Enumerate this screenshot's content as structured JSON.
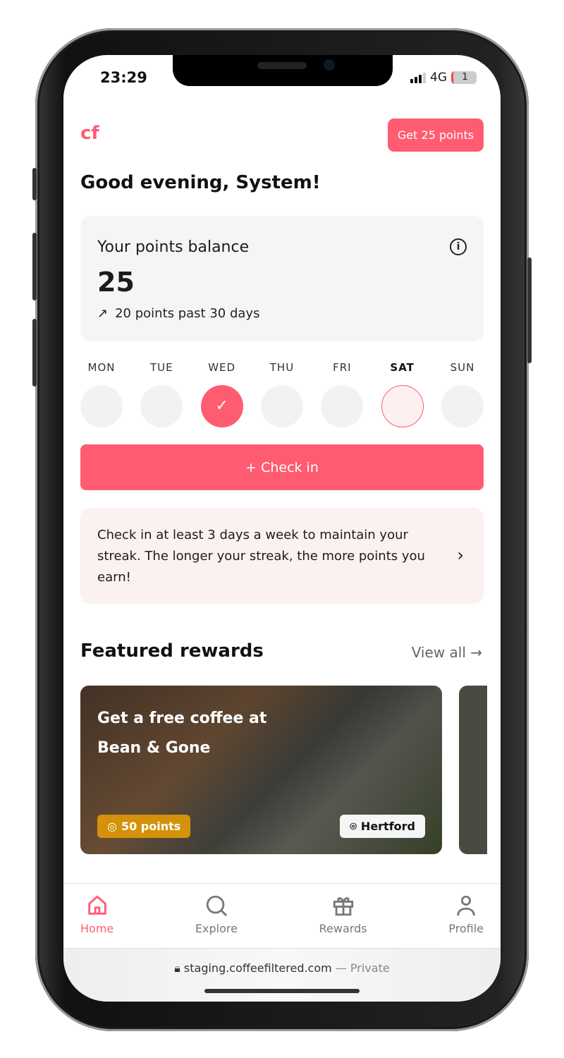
{
  "status": {
    "time": "23:29",
    "network": "4G",
    "battery": "1"
  },
  "header": {
    "logo": "cf",
    "cta": "Get 25 points"
  },
  "greeting": "Good evening, System!",
  "points": {
    "title": "Your points balance",
    "value": "25",
    "trend": "20 points past 30 days"
  },
  "week": [
    {
      "label": "MON",
      "state": "empty"
    },
    {
      "label": "TUE",
      "state": "empty"
    },
    {
      "label": "WED",
      "state": "checked"
    },
    {
      "label": "THU",
      "state": "empty"
    },
    {
      "label": "FRI",
      "state": "empty"
    },
    {
      "label": "SAT",
      "state": "today"
    },
    {
      "label": "SUN",
      "state": "empty"
    }
  ],
  "checkin": {
    "label": "+ Check in"
  },
  "tip": "Check in at least 3 days a week to maintain your streak. The longer your streak, the more points you earn!",
  "featured": {
    "title": "Featured rewards",
    "view_all": "View all",
    "items": [
      {
        "title": "Get a free coffee at Bean & Gone",
        "points": "50 points",
        "location": "Hertford"
      }
    ]
  },
  "nav": [
    {
      "label": "Home",
      "active": true
    },
    {
      "label": "Explore"
    },
    {
      "label": "Rewards"
    },
    {
      "label": "Profile"
    }
  ],
  "browser": {
    "url": "staging.coffeefiltered.com",
    "mode": "— Private"
  },
  "colors": {
    "accent": "#ff5c72",
    "points_badge": "#d4920a",
    "tip_bg": "#fbf1ef"
  }
}
